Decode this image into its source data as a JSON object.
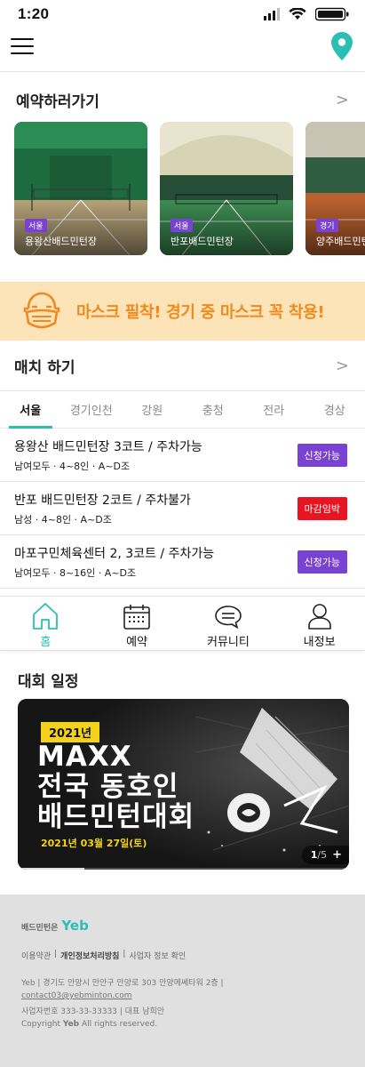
{
  "status_bar": {
    "time": "1:20"
  },
  "booking": {
    "title": "예약하러가기",
    "more": ">",
    "venues": [
      {
        "region": "서울",
        "name": "용왕산배드민턴장",
        "color": "#1f7a46"
      },
      {
        "region": "서울",
        "name": "반포배드민턴장",
        "color": "#3a7a3c"
      },
      {
        "region": "경기",
        "name": "양주배드민턴장",
        "color": "#a04f2a"
      }
    ]
  },
  "mask_banner": {
    "text": "마스크 필착! 경기 중 마스크 꼭 착용!",
    "color": "#f08a1c"
  },
  "match": {
    "title": "매치 하기",
    "more": ">",
    "tabs": [
      "서울",
      "경기인천",
      "강원",
      "충청",
      "전라",
      "경상"
    ],
    "active_tab": "서울",
    "rows": [
      {
        "title": "용왕산 배드민턴장 3코트 / 주차가능",
        "meta": "남여모두  ·  4~8인  ·  A~D조",
        "badge": "신청가능",
        "badge_color": "#7a42d4"
      },
      {
        "title": "반포 배드민턴장 2코트 / 주차불가",
        "meta": "남성  ·  4~8인  ·  A~D조",
        "badge": "마감임박",
        "badge_color": "#e8141f"
      },
      {
        "title": "마포구민체육센터 2, 3코트 / 주차가능",
        "meta": "남여모두  ·  8~16인  ·  A~D조",
        "badge": "신청가능",
        "badge_color": "#7a42d4"
      }
    ]
  },
  "bottom_nav": {
    "items": [
      {
        "label": "홈",
        "icon": "home-icon",
        "active": true
      },
      {
        "label": "예약",
        "icon": "calendar-icon",
        "active": false
      },
      {
        "label": "커뮤니티",
        "icon": "chat-icon",
        "active": false
      },
      {
        "label": "내정보",
        "icon": "user-icon",
        "active": false
      }
    ]
  },
  "tournament": {
    "title": "대회 일정",
    "banner": {
      "year": "2021년",
      "line1": "MAXX",
      "line2": "전국 동호인",
      "line3": "배드민턴대회",
      "date": "2021년 03월 27일(토)",
      "page_current": "1",
      "page_total": "/5",
      "page_plus": "+",
      "progress": 0.2
    }
  },
  "footer": {
    "brand_prefix": "배드민턴은",
    "brand_name": "Yeb",
    "links": [
      "이용약관",
      "|",
      "개인정보처리방침",
      "|",
      "사업자 정보 확인"
    ],
    "address": "Yeb  |  경기도 안양시 만안구 안양로 303 안양메쎄타워 2층  |",
    "email": "contact03@yebminton.com",
    "biz": "사업자번호 333-33-33333  |  대표 남희안",
    "copyright_prefix": "Copyright ",
    "copyright_brand": "Yeb",
    "copyright_suffix": " All rights reserved.",
    "accent": "#2bbfb3"
  }
}
